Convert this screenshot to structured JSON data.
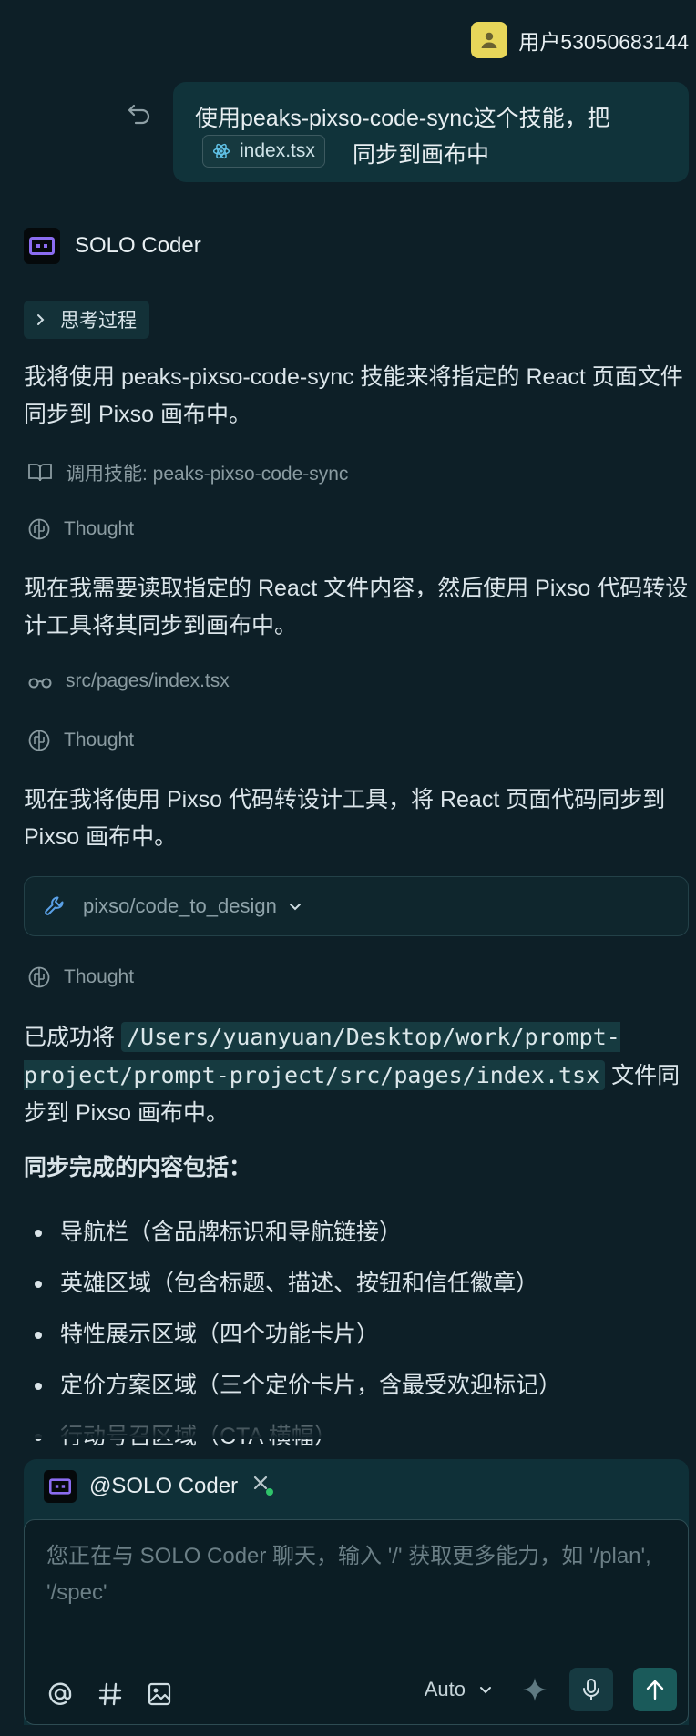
{
  "user": {
    "name": "用户53050683144"
  },
  "user_message": {
    "text_before": "使用peaks-pixso-code-sync这个技能，把",
    "file_chip": "index.tsx",
    "text_after": "同步到画布中"
  },
  "assistant": {
    "name": "SOLO Coder",
    "thinking_label": "思考过程",
    "para1": "我将使用 peaks-pixso-code-sync 技能来将指定的 React 页面文件同步到 Pixso 画布中。",
    "skill_call": "调用技能: peaks-pixso-code-sync",
    "thought_label": "Thought",
    "para2": "现在我需要读取指定的 React 文件内容，然后使用 Pixso 代码转设计工具将其同步到画布中。",
    "file_read": "src/pages/index.tsx",
    "para3": "现在我将使用 Pixso 代码转设计工具，将 React 页面代码同步到 Pixso 画布中。",
    "tool_name": "pixso/code_to_design",
    "result_prefix": "已成功将",
    "result_path": "/Users/yuanyuan/Desktop/work/prompt-project/prompt-project/src/pages/index.tsx",
    "result_suffix": "文件同步到 Pixso 画布中。",
    "summary_heading": "同步完成的内容包括：",
    "items": [
      "导航栏（含品牌标识和导航链接）",
      "英雄区域（包含标题、描述、按钮和信任徽章）",
      "特性展示区域（四个功能卡片）",
      "定价方案区域（三个定价卡片，含最受欢迎标记）",
      "行动号召区域（CTA 横幅）"
    ]
  },
  "composer": {
    "mention": "@SOLO Coder",
    "placeholder": "您正在与 SOLO Coder 聊天，输入 '/' 获取更多能力，如 '/plan', '/spec'",
    "mode": "Auto"
  },
  "colors": {
    "background": "#0d1f27",
    "bubble": "#10333a",
    "accent_purple": "#8b6cf0",
    "send": "#1a5a5a",
    "status_green": "#2fc36a"
  }
}
